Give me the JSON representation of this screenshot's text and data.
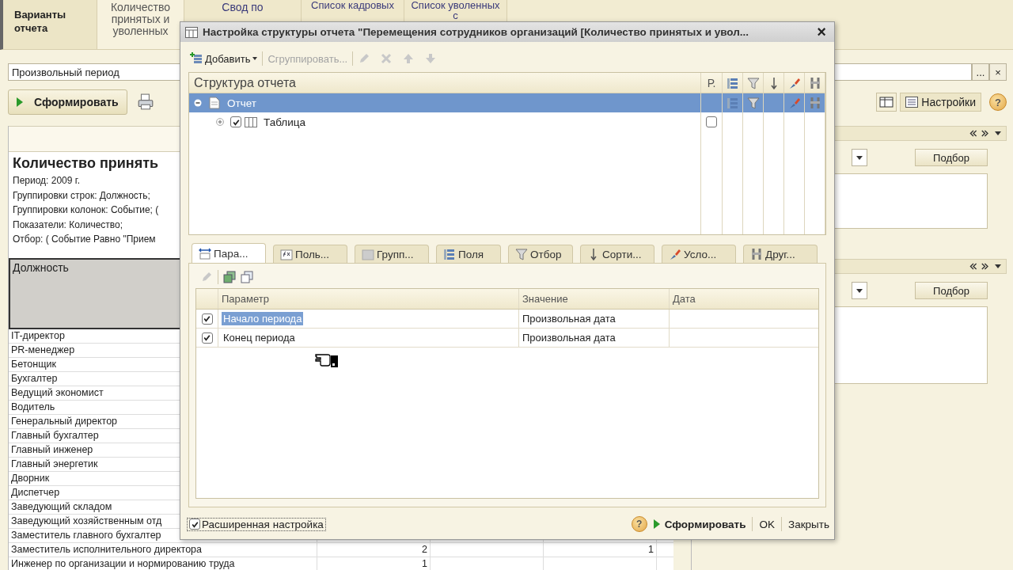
{
  "variants_label": "Варианты отчета",
  "tabs": [
    {
      "label": "Количество принятых и уволенных",
      "selected": true
    },
    {
      "label": "Свод по",
      "selected": false
    },
    {
      "label": "Список кадровых",
      "selected": false
    },
    {
      "label": "Список уволенных с",
      "selected": false
    }
  ],
  "period_field": {
    "value": "Произвольный период",
    "choose_button": "...",
    "clear_button": "×"
  },
  "generate_button": "Сформировать",
  "settings_button": "Настройки",
  "help_button": "?",
  "report": {
    "title": "Количество принять",
    "lines": [
      "Период: 2009 г.",
      "Группировки строк: Должность;",
      "Группировки колонок: Событие; (",
      "Показатели: Количество;",
      "Отбор: ( Событие Равно \"Прием"
    ],
    "column": "Должность",
    "rows": [
      {
        "name": "IT-директор"
      },
      {
        "name": "PR-менеджер"
      },
      {
        "name": "Бетонщик"
      },
      {
        "name": "Бухгалтер"
      },
      {
        "name": "Ведущий экономист"
      },
      {
        "name": "Водитель"
      },
      {
        "name": "Генеральный директор"
      },
      {
        "name": "Главный бухгалтер"
      },
      {
        "name": "Главный инженер"
      },
      {
        "name": "Главный энергетик"
      },
      {
        "name": "Дворник"
      },
      {
        "name": "Диспетчер"
      },
      {
        "name": "Заведующий складом"
      },
      {
        "name": "Заведующий хозяйственным отд"
      },
      {
        "name": "Заместитель главного бухгалтер"
      },
      {
        "name": "Заместитель исполнительного директора",
        "column_2": "2",
        "column_4": "1"
      },
      {
        "name": "Инженер по организации и нормированию труда",
        "column_2": "1"
      }
    ]
  },
  "side_sections": [
    {
      "pick_button": "Подбор"
    },
    {
      "pick_button": "Подбор"
    }
  ],
  "dialog": {
    "title": "Настройка структуры отчета \"Перемещения сотрудников организаций [Количество принятых и увол...",
    "close": "×",
    "toolbar": {
      "add": "Добавить",
      "group": "Сгруппировать..."
    },
    "tree": {
      "column": "Структура отчета",
      "flag_column": "Р.",
      "rows": [
        {
          "label": "Отчет",
          "selected": true,
          "indicators": [
            true,
            true,
            false,
            true,
            true
          ],
          "children": [
            {
              "label": "Таблица",
              "selected": false,
              "checked": true,
              "flag": false,
              "expanded": false
            }
          ]
        }
      ]
    },
    "tabs": [
      {
        "label": "Пара...",
        "selected": true
      },
      {
        "label": "Поль...",
        "selected": false
      },
      {
        "label": "Групп...",
        "selected": false
      },
      {
        "label": "Поля",
        "selected": false
      },
      {
        "label": "Отбор",
        "selected": false
      },
      {
        "label": "Сорти...",
        "selected": false
      },
      {
        "label": "Усло...",
        "selected": false
      },
      {
        "label": "Друг...",
        "selected": false
      }
    ],
    "params": {
      "columns": [
        "Параметр",
        "Значение",
        "Дата"
      ],
      "rows": [
        {
          "checked": true,
          "selected": true,
          "name": "Начало периода",
          "value": "Произвольная дата"
        },
        {
          "checked": true,
          "selected": false,
          "name": "Конец периода",
          "value": "Произвольная дата"
        }
      ]
    },
    "advanced": {
      "label": "Расширенная настройка",
      "checked": true
    },
    "help": "?",
    "generate": "Сформировать",
    "ok": "OK",
    "close_button": "Закрыть"
  }
}
